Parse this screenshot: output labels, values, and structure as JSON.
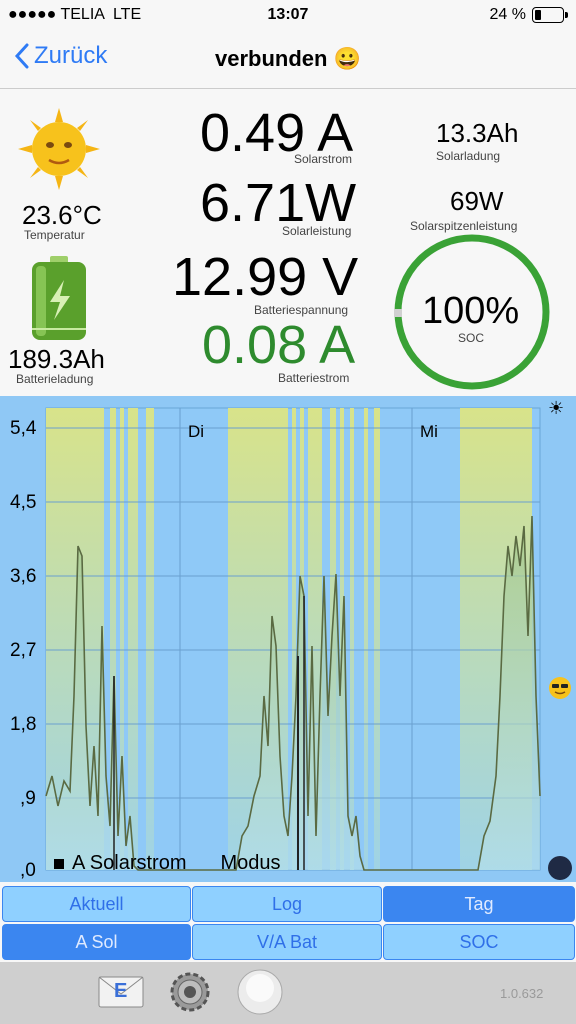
{
  "status": {
    "carrier": "TELIA",
    "network": "LTE",
    "time": "13:07",
    "battery": "24 %"
  },
  "nav": {
    "back_label": "Zurück",
    "title": "verbunden 😀"
  },
  "stats": {
    "temperature": {
      "value": "23.6°C",
      "label": "Temperatur"
    },
    "battery_charge": {
      "value": "189.3Ah",
      "label": "Batterieladung"
    },
    "solar_current": {
      "value": "0.49 A",
      "label": "Solarstrom"
    },
    "solar_power": {
      "value": "6.71W",
      "label": "Solarleistung"
    },
    "battery_voltage": {
      "value": "12.99 V",
      "label": "Batteriespannung"
    },
    "battery_current": {
      "value": "0.08 A",
      "label": "Batteriestrom"
    },
    "solar_charge": {
      "value": "13.3Ah",
      "label": "Solarladung"
    },
    "peak_power": {
      "value": "69W",
      "label": "Solarspitzenleistung"
    },
    "soc": {
      "value": "100%",
      "label": "SOC",
      "fraction": 1.0
    }
  },
  "chart": {
    "y_ticks": [
      "5,4",
      "4,5",
      "3,6",
      "2,7",
      "1,8",
      ",9",
      ",0"
    ],
    "day_labels": [
      "Di",
      "Mi"
    ],
    "legend": {
      "series": "A Solarstrom",
      "mode": "Modus"
    }
  },
  "tabs_row1": [
    "Aktuell",
    "Log",
    "Tag"
  ],
  "tabs_row2": [
    "A Sol",
    "V/A Bat",
    "SOC"
  ],
  "footer": {
    "mail_icon_letter": "E",
    "version": "1.0.632"
  },
  "colors": {
    "accent": "#2f7bf5",
    "green": "#2e8b2e",
    "soc_ring": "#3aa236",
    "chart_bg": "#8fc8f5"
  }
}
